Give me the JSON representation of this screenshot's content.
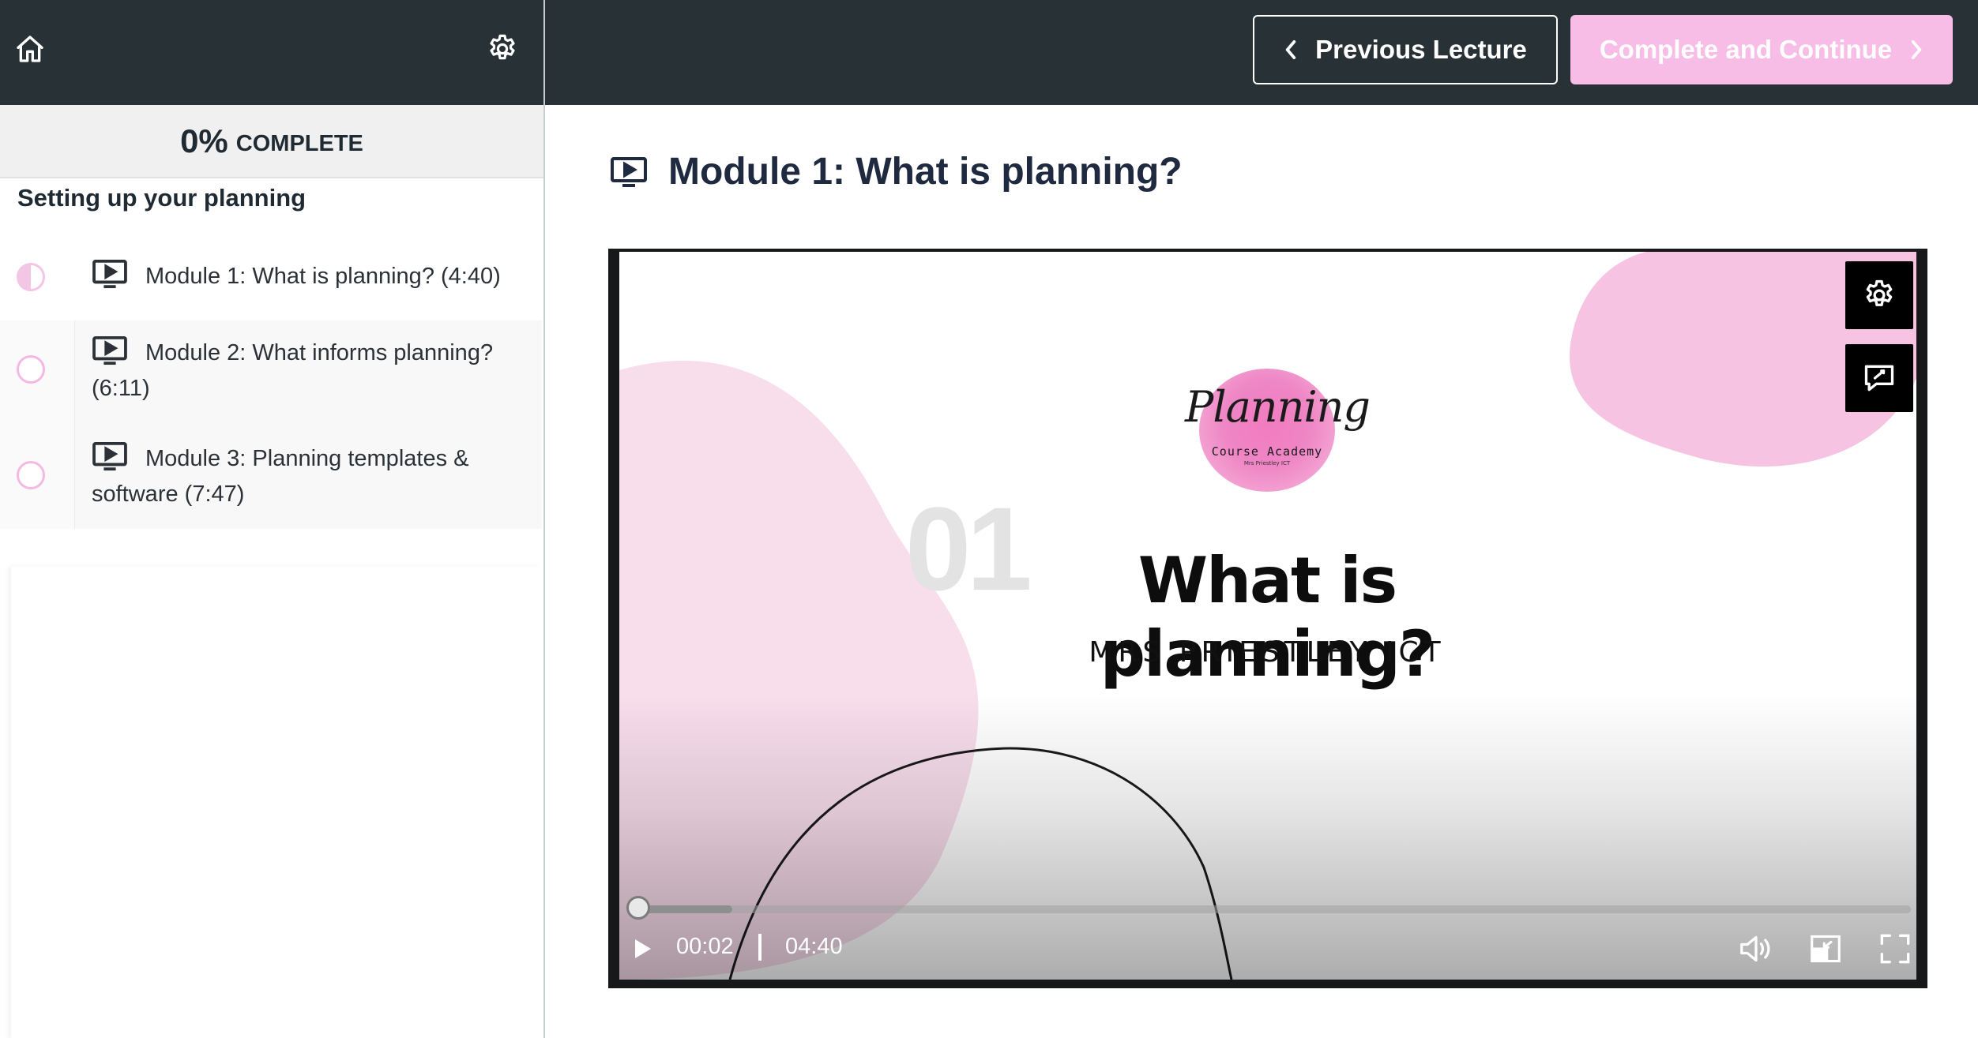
{
  "header": {
    "home_icon": "home-icon",
    "settings_icon": "gear-icon",
    "previous_button": "Previous Lecture",
    "next_button": "Complete and Continue",
    "next_button_color": "#f7bde6",
    "bar_color": "#283236"
  },
  "sidebar": {
    "progress": {
      "percent": "0%",
      "label": "COMPLETE"
    },
    "section_title": "Setting up your planning",
    "lectures": [
      {
        "title": "Module 1: What is planning? (4:40)",
        "status": "in-progress"
      },
      {
        "title": "Module 2: What informs planning? (6:11)",
        "status": "not-started"
      },
      {
        "title": "Module 3: Planning templates & software (7:47)",
        "status": "not-started"
      }
    ]
  },
  "main": {
    "lecture_title": "Module 1: What is planning?",
    "slide": {
      "logo_script": "Planning",
      "logo_subtitle": "Course Academy",
      "logo_tiny": "Mrs Priestley ICT",
      "number": "01",
      "title": "What is planning?",
      "subtitle": "MRS PRIESTLEY ICT",
      "accent_color": "#f6c3e3"
    },
    "player": {
      "current_time": "00:02",
      "duration": "04:40",
      "played_fraction": 0.007,
      "buffered_fraction": 0.08,
      "controls": [
        "play-icon",
        "volume-icon",
        "picture-in-picture-icon",
        "fullscreen-icon"
      ],
      "overlay_controls": [
        "gear-icon",
        "captions-icon"
      ]
    }
  }
}
